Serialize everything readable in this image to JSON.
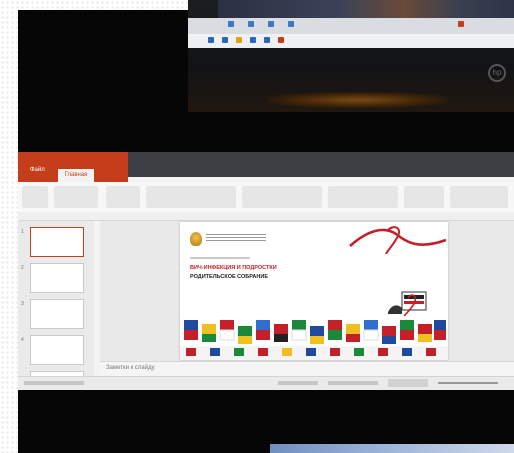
{
  "powerpoint": {
    "file_tab": "Файл",
    "home_tab": "Главная",
    "notes_placeholder": "Заметки к слайду",
    "slide": {
      "title": "ВИЧ-ИНФЕКЦИЯ И ПОДРОСТКИ",
      "subtitle": "РОДИТЕЛЬСКОЕ СОБРАНИЕ"
    }
  },
  "colors": {
    "powerpoint_accent": "#c43e1c",
    "aids_red": "#c4202a"
  }
}
